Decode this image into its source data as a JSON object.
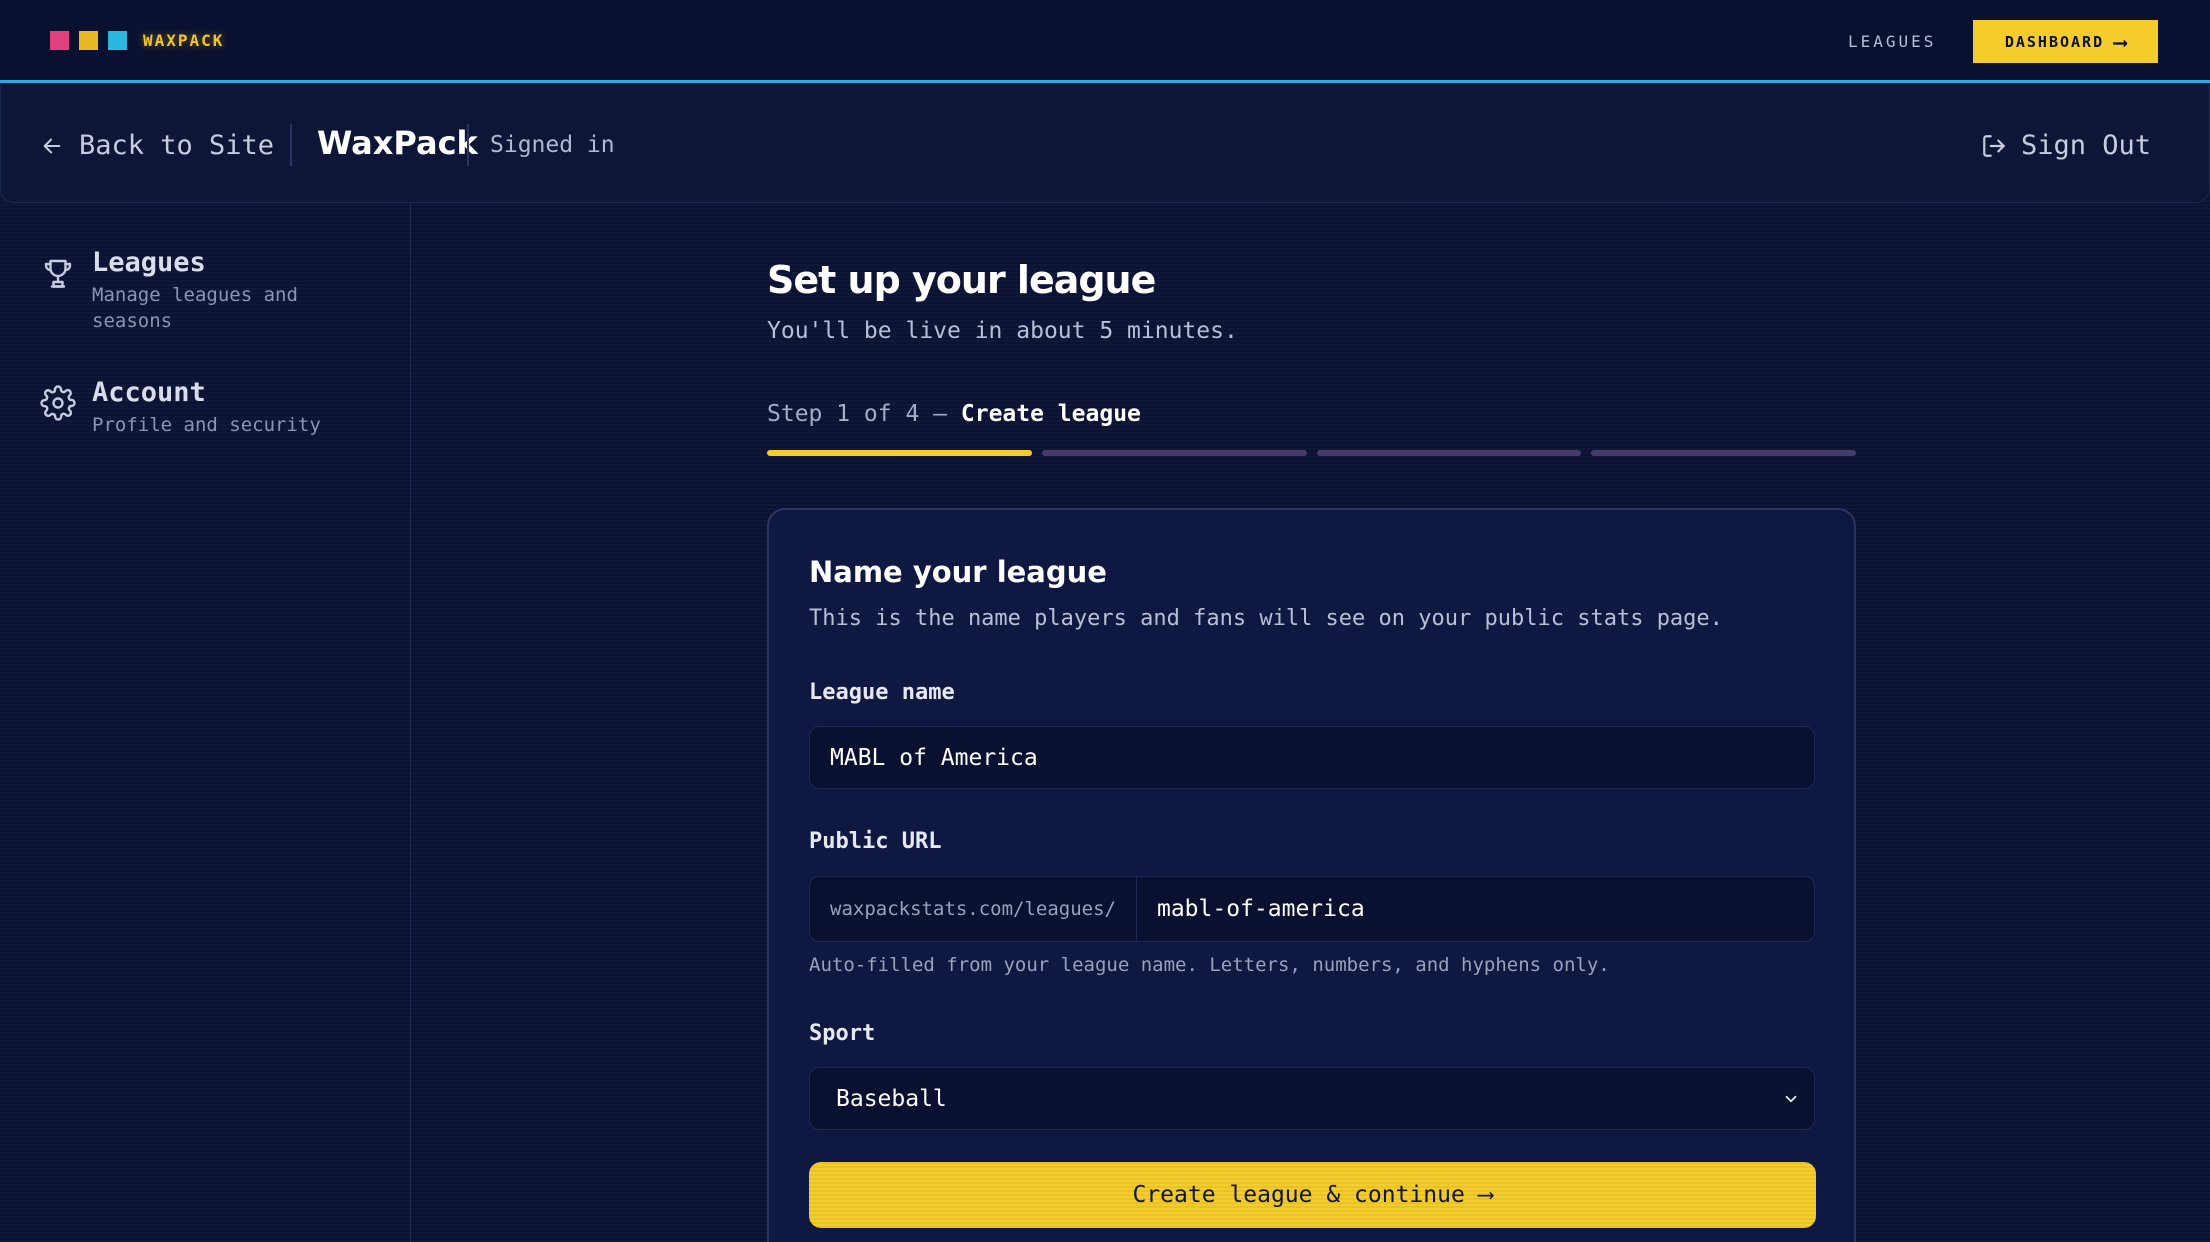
{
  "topbar": {
    "logo_text": "WAXPACK",
    "logo_colors": [
      "#e0407e",
      "#e9b826",
      "#2bb6e0"
    ],
    "nav_leagues": "LEAGUES",
    "dashboard_label": "DASHBOARD",
    "dashboard_arrow": "⟶"
  },
  "header": {
    "back_label": "Back to Site",
    "brand": "WaxPack",
    "status": "Signed in",
    "sign_out_label": "Sign Out"
  },
  "sidebar": {
    "items": [
      {
        "title": "Leagues",
        "subtitle_line1": "Manage leagues and",
        "subtitle_line2": "seasons",
        "icon": "trophy-icon"
      },
      {
        "title": "Account",
        "subtitle_line1": "Profile and security",
        "icon": "gear-icon"
      }
    ]
  },
  "main": {
    "title": "Set up your league",
    "subtitle": "You'll be live in about 5 minutes.",
    "step_prefix": "Step 1 of 4 — ",
    "step_name": "Create league",
    "progress": {
      "current": 1,
      "total": 4,
      "accent": "#f4cc2b"
    }
  },
  "form": {
    "title": "Name your league",
    "subtitle": "This is the name players and fans will see on your public stats page.",
    "league_name_label": "League name",
    "league_name_value": "MABL of America",
    "url_label": "Public URL",
    "url_prefix": "waxpackstats.com/leagues/",
    "url_value": "mabl-of-america",
    "url_hint": "Auto-filled from your league name. Letters, numbers, and hyphens only.",
    "sport_label": "Sport",
    "sport_value": "Baseball",
    "submit_label": "Create league & continue ⟶"
  }
}
